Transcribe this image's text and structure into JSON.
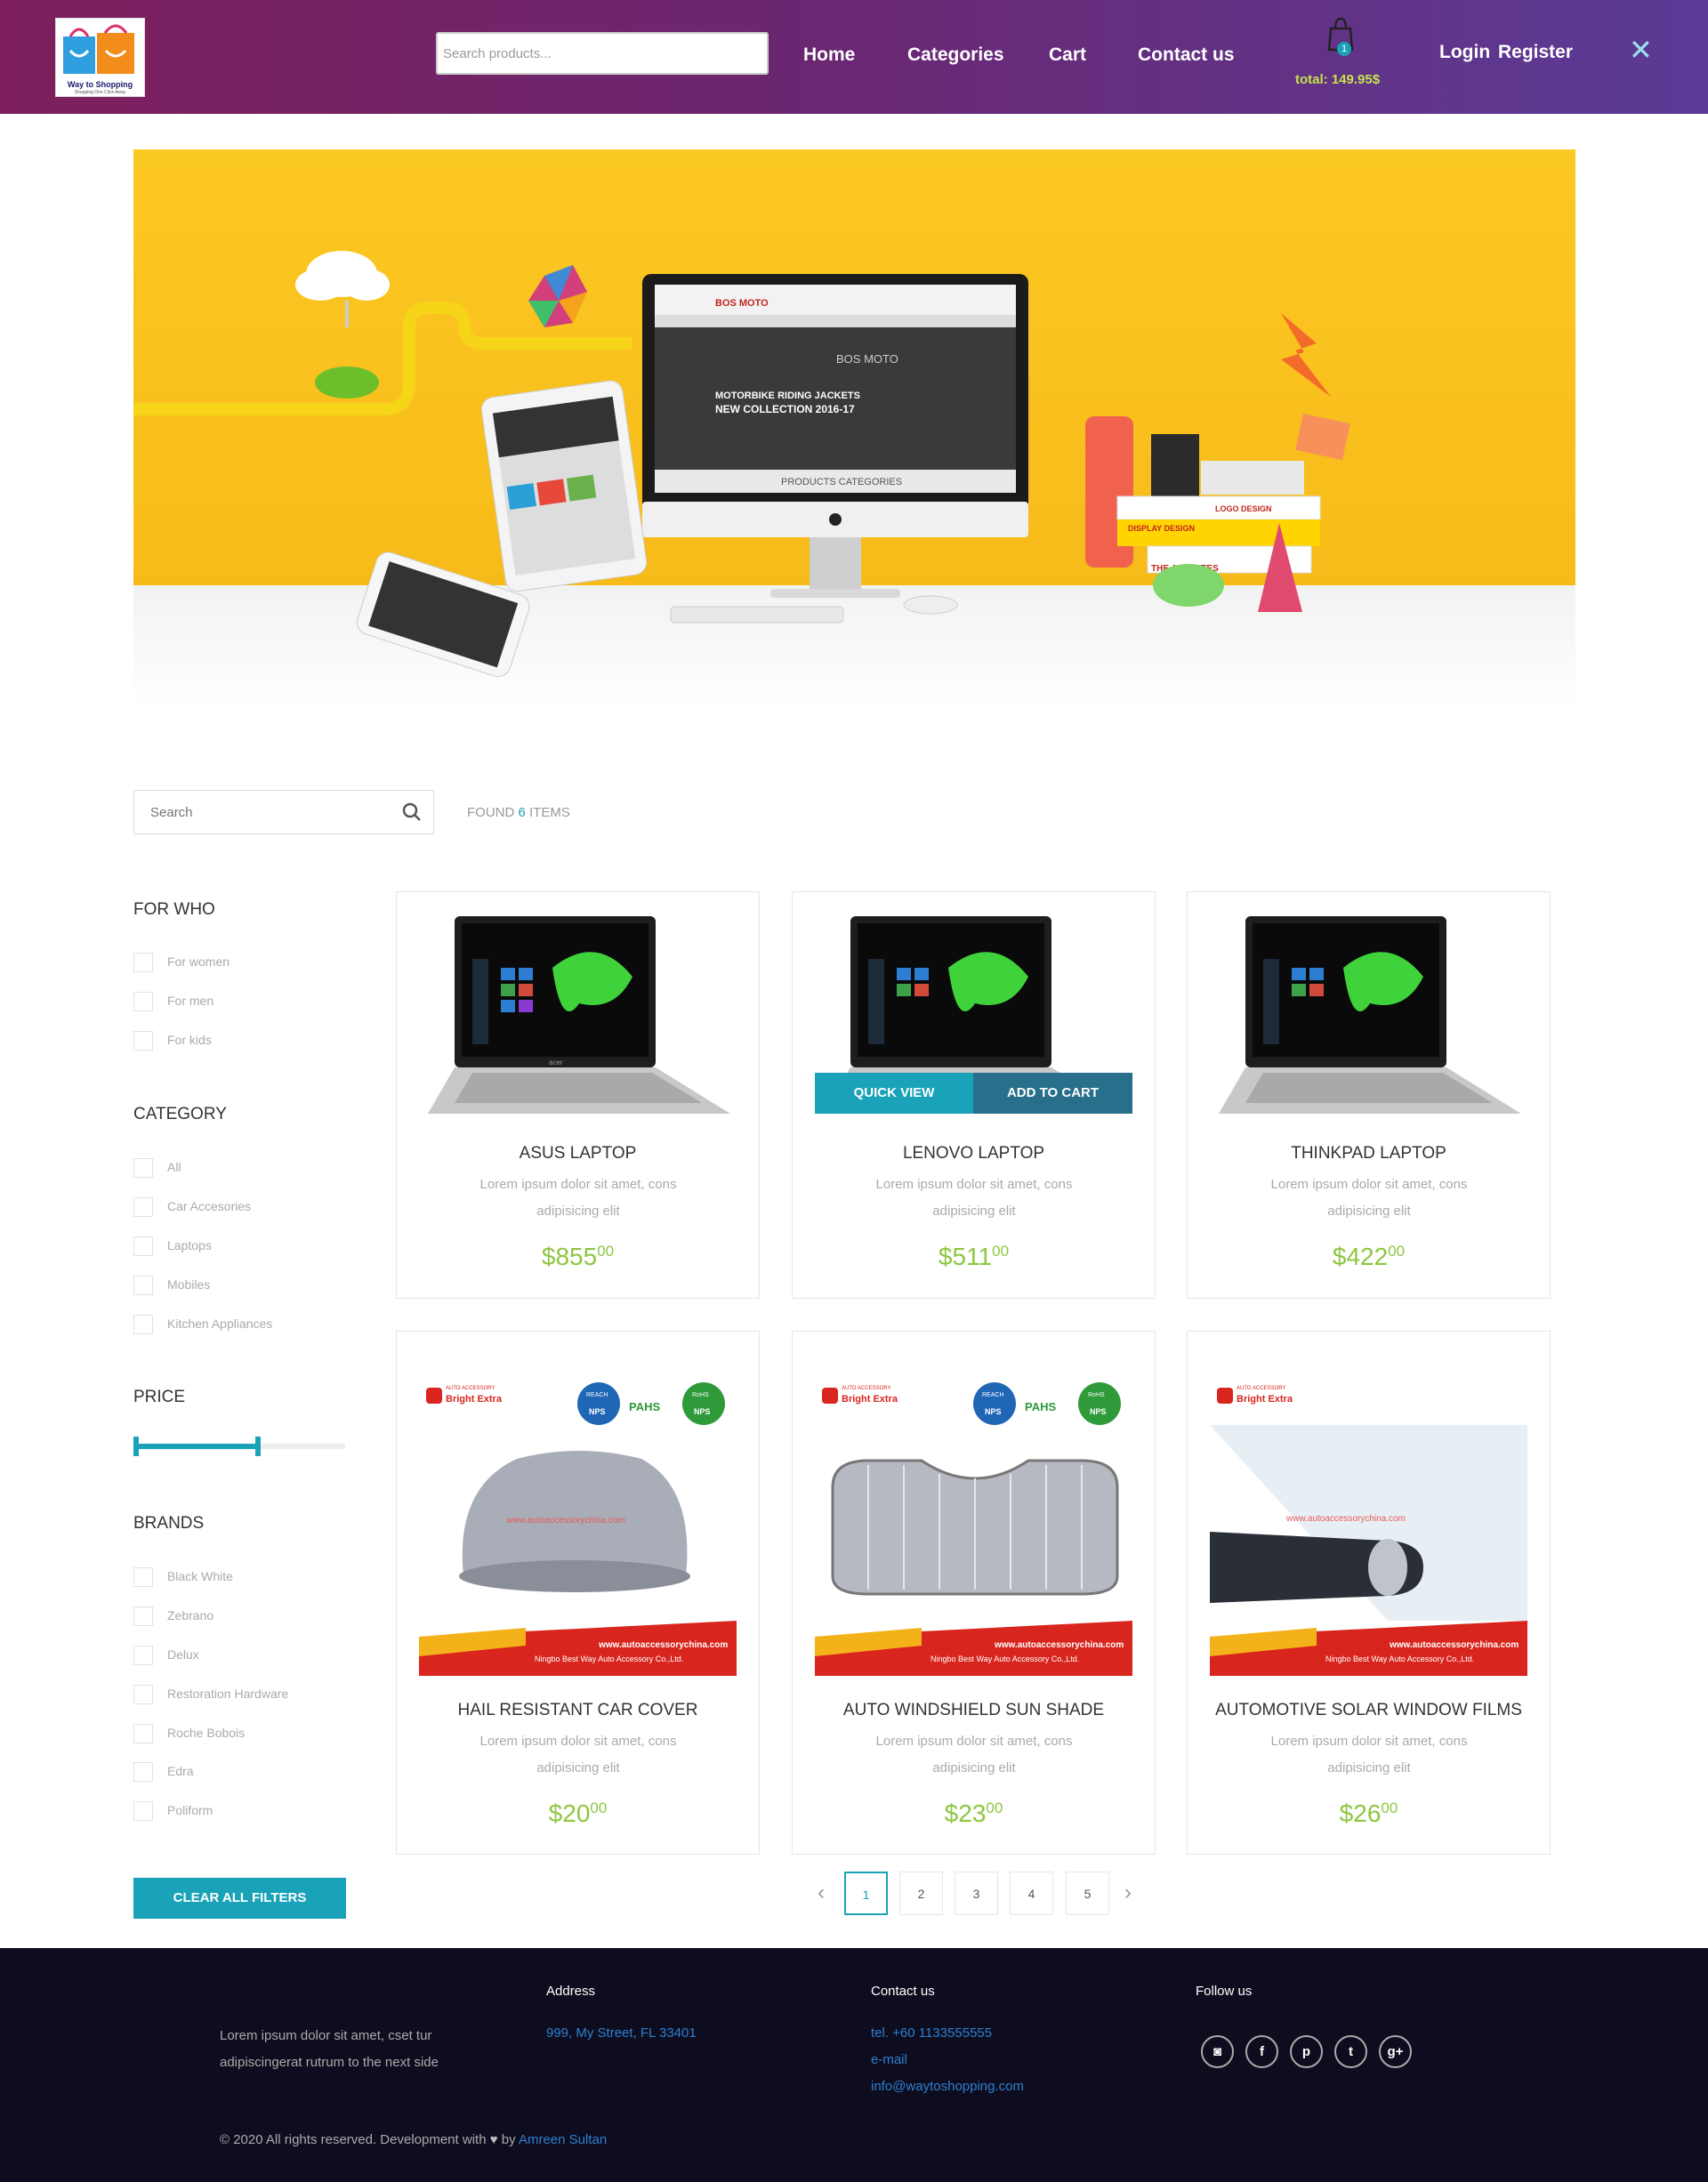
{
  "header": {
    "logo_text": "Way to Shopping",
    "logo_sub": "Shopping One Click Away",
    "search_placeholder": "Search products...",
    "nav": [
      "Home",
      "Categories",
      "Cart",
      "Contact us"
    ],
    "cart_count": "1",
    "cart_total": "total: 149.95$",
    "login": "Login",
    "register": "Register",
    "close": "✕"
  },
  "hero": {
    "screen_brand": "BOS MOTO",
    "screen_headline_1": "MOTORBIKE RIDING JACKETS",
    "screen_headline_2": "NEW COLLECTION 2016-17",
    "screen_footer": "PRODUCTS CATEGORIES",
    "book_1": "LOGO DESIGN",
    "book_2": "DISPLAY DESIGN",
    "book_3": "THE ACCE  ITES"
  },
  "filters": {
    "search_placeholder": "Search",
    "found_prefix": "FOUND ",
    "found_count": "6",
    "found_suffix": " ITEMS",
    "for_who_title": "FOR WHO",
    "for_who": [
      "For women",
      "For men",
      "For kids"
    ],
    "category_title": "CATEGORY",
    "categories": [
      "All",
      "Car Accesories",
      "Laptops",
      "Mobiles",
      "Kitchen Appliances"
    ],
    "price_title": "PRICE",
    "price_range": [
      0,
      0.6
    ],
    "brands_title": "BRANDS",
    "brands": [
      "Black White",
      "Zebrano",
      "Delux",
      "Restoration Hardware",
      "Roche Bobois",
      "Edra",
      "Poliform"
    ],
    "clear_label": "CLEAR ALL FILTERS"
  },
  "products": [
    {
      "title": "ASUS LAPTOP",
      "desc": "Lorem ipsum dolor sit amet, cons adipisicing elit",
      "price": "$855",
      "cents": "00"
    },
    {
      "title": "LENOVO LAPTOP",
      "desc": "Lorem ipsum dolor sit amet, cons adipisicing elit",
      "price": "$511",
      "cents": "00",
      "quick_view": "QUICK VIEW",
      "add_to_cart": "ADD TO CART"
    },
    {
      "title": "THINKPAD LAPTOP",
      "desc": "Lorem ipsum dolor sit amet, cons adipisicing elit",
      "price": "$422",
      "cents": "00"
    },
    {
      "title": "HAIL RESISTANT CAR COVER",
      "desc": "Lorem ipsum dolor sit amet, cons adipisicing elit",
      "price": "$20",
      "cents": "00"
    },
    {
      "title": "AUTO WINDSHIELD SUN SHADE",
      "desc": "Lorem ipsum dolor sit amet, cons adipisicing elit",
      "price": "$23",
      "cents": "00"
    },
    {
      "title": "AUTOMOTIVE SOLAR WINDOW FILMS",
      "desc": "Lorem ipsum dolor sit amet, cons adipisicing elit",
      "price": "$26",
      "cents": "00"
    }
  ],
  "product_image_text": {
    "brand": "Bright Extra",
    "brand_small": "AUTO ACCESSORY",
    "url": "www.autoaccessorychina.com",
    "company": "Ningbo Best Way Auto Accessory Co.,Ltd.",
    "badge_1": "NPS",
    "badge_2": "PAHS",
    "badge_3": "NPS",
    "badge_1_top": "REACH",
    "badge_3_top": "RoHS",
    "laptop_brand": "acer"
  },
  "pagination": {
    "prev": "‹",
    "pages": [
      "1",
      "2",
      "3",
      "4",
      "5"
    ],
    "next": "›",
    "active": "1"
  },
  "footer": {
    "about": "Lorem ipsum dolor sit amet, cset tur adipiscingerat rutrum to the next side",
    "address_title": "Address",
    "address": "999, My Street, FL 33401",
    "contact_title": "Contact us",
    "tel": "tel. +60 1133555555",
    "email_label": "e-mail",
    "email": "info@waytoshopping.com",
    "follow_title": "Follow us",
    "copyright_prefix": "© 2020 All rights reserved. Development with",
    "copyright_by": "by",
    "author": "Amreen Sultan"
  },
  "colors": {
    "accent": "#1aa3b8",
    "price": "#8dc63f",
    "header_start": "#7d1f5c",
    "header_end": "#5b3b96",
    "footer_bg": "#0d0d1f",
    "cart_total": "#c6e34a"
  }
}
